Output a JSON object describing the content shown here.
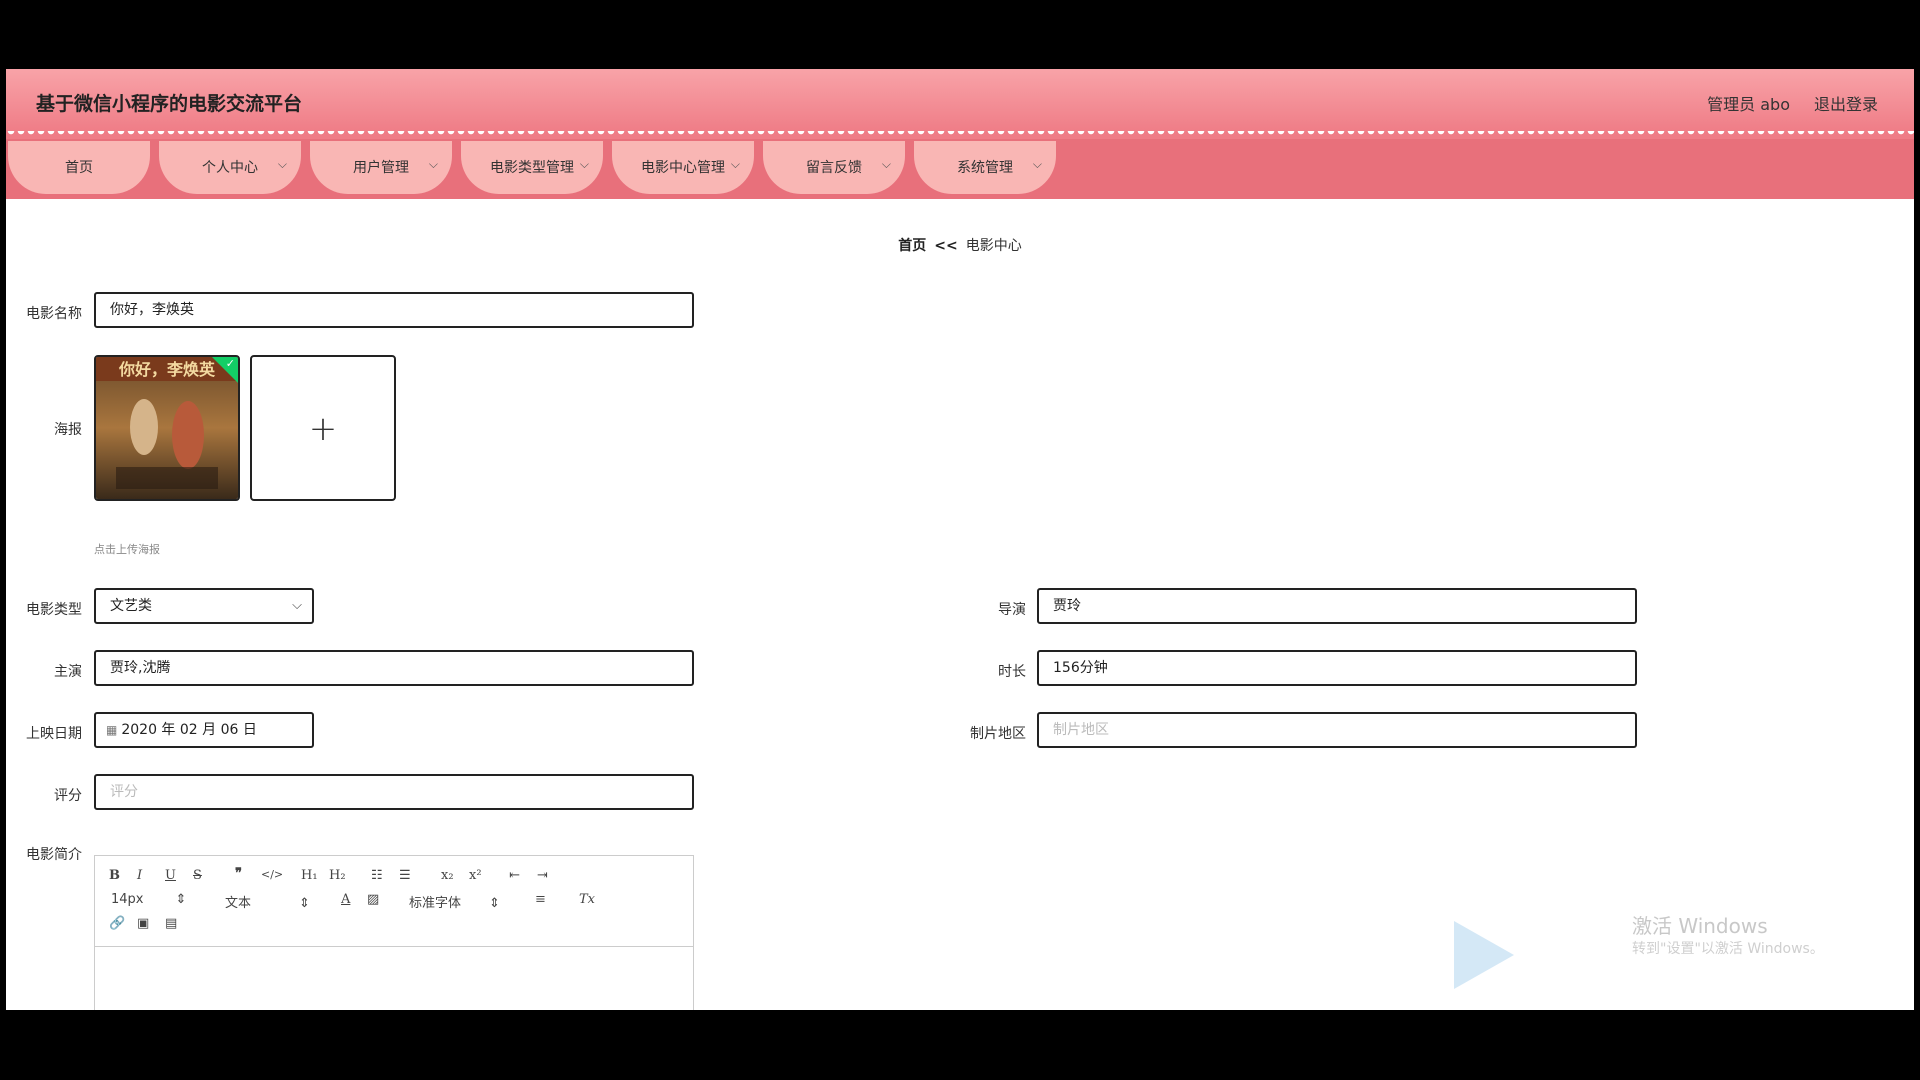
{
  "header": {
    "title": "基于微信小程序的电影交流平台",
    "user": "管理员 abo",
    "logout": "退出登录"
  },
  "nav": [
    {
      "label": "首页",
      "dropdown": false
    },
    {
      "label": "个人中心",
      "dropdown": true
    },
    {
      "label": "用户管理",
      "dropdown": true
    },
    {
      "label": "电影类型管理",
      "dropdown": true
    },
    {
      "label": "电影中心管理",
      "dropdown": true
    },
    {
      "label": "留言反馈",
      "dropdown": true
    },
    {
      "label": "系统管理",
      "dropdown": true
    }
  ],
  "breadcrumb": {
    "home": "首页",
    "sep": "<<",
    "current": "电影中心"
  },
  "form": {
    "name": {
      "label": "电影名称",
      "value": "你好，李焕英"
    },
    "poster": {
      "label": "海报",
      "hint": "点击上传海报",
      "image_title": "你好，李焕英"
    },
    "type": {
      "label": "电影类型",
      "value": "文艺类"
    },
    "director": {
      "label": "导演",
      "value": "贾玲"
    },
    "actors": {
      "label": "主演",
      "value": "贾玲,沈腾"
    },
    "duration": {
      "label": "时长",
      "value": "156分钟"
    },
    "release": {
      "label": "上映日期",
      "value": "2020 年 02 月 06 日"
    },
    "region": {
      "label": "制片地区",
      "placeholder": "制片地区"
    },
    "score": {
      "label": "评分",
      "placeholder": "评分"
    },
    "intro": {
      "label": "电影简介"
    }
  },
  "editor": {
    "font_size": "14px",
    "text_style": "文本",
    "font_family": "标准字体",
    "buttons": [
      "bold",
      "italic",
      "underline",
      "strike",
      "blockquote",
      "code",
      "h1",
      "h2",
      "ordered-list",
      "bullet-list",
      "subscript",
      "superscript",
      "outdent",
      "indent",
      "font-color",
      "background-color",
      "align",
      "clean",
      "link",
      "image",
      "video"
    ]
  },
  "watermark": {
    "line1": "激活 Windows",
    "line2": "转到\"设置\"以激活 Windows。"
  },
  "colors": {
    "header_top": "#f8a3a8",
    "header_bottom": "#ef7c86",
    "nav_bg": "#e8707b",
    "tab_bg": "#f9b6b4",
    "check": "#13ce66"
  }
}
